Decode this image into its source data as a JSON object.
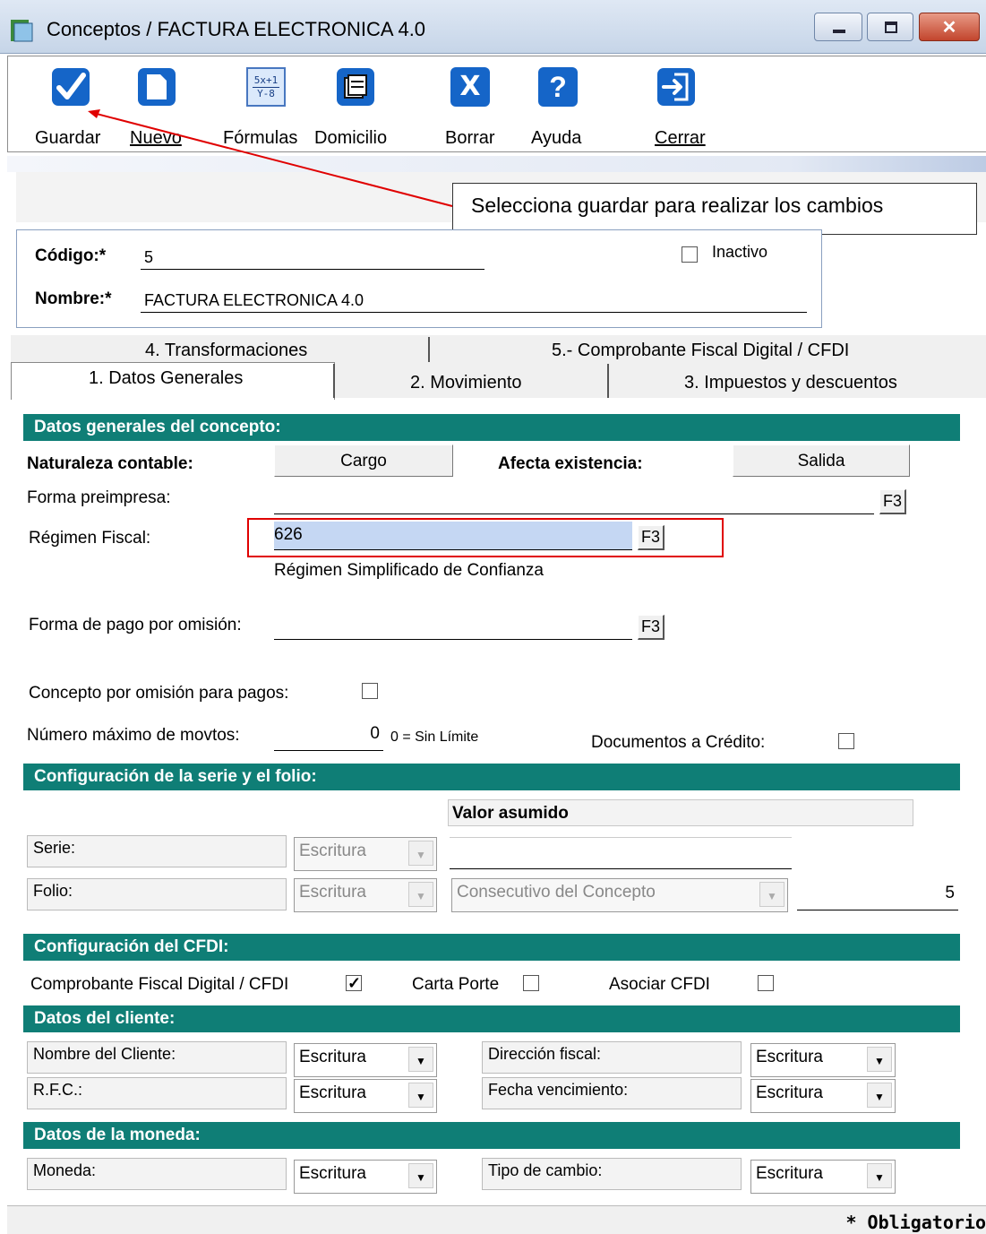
{
  "window": {
    "title": "Conceptos / FACTURA ELECTRONICA 4.0",
    "minimize_glyph": "",
    "maximize_glyph": "",
    "close_glyph": "✕"
  },
  "toolbar": {
    "guardar": "Guardar",
    "nuevo": "Nuevo",
    "formulas": "Fórmulas",
    "formulas_icon_text_top": "5x+1",
    "formulas_icon_text_bottom": "Y-8",
    "domicilio": "Domicilio",
    "borrar": "Borrar",
    "borrar_icon_text": "X",
    "ayuda": "Ayuda",
    "ayuda_icon_text": "?",
    "cerrar": "Cerrar"
  },
  "callout": {
    "text": "Selecciona guardar para realizar los cambios",
    "arrow_color": "#e00000"
  },
  "header": {
    "codigo_label": "Código:*",
    "codigo_value": "5",
    "nombre_label": "Nombre:*",
    "nombre_value": "FACTURA ELECTRONICA 4.0",
    "inactivo_label": "Inactivo",
    "inactivo_checked": false
  },
  "tabs": {
    "row_back": [
      "4. Transformaciones",
      "5.- Comprobante Fiscal Digital / CFDI"
    ],
    "row_front": [
      "1. Datos Generales",
      "2. Movimiento",
      "3. Impuestos y descuentos"
    ],
    "active": "1. Datos Generales"
  },
  "datos_generales": {
    "section_title": "Datos generales del concepto:",
    "naturaleza_label": "Naturaleza contable:",
    "naturaleza_value": "Cargo",
    "afecta_label": "Afecta existencia:",
    "afecta_value": "Salida",
    "forma_preimpresa_label": "Forma preimpresa:",
    "forma_preimpresa_value": "",
    "f3_label": "F3",
    "regimen_label": "Régimen Fiscal:",
    "regimen_value": "626",
    "regimen_desc": "Régimen Simplificado de Confianza",
    "forma_pago_label": "Forma de pago por omisión:",
    "forma_pago_value": "",
    "concepto_pagos_label": "Concepto por omisión para pagos:",
    "concepto_pagos_checked": false,
    "max_movtos_label": "Número máximo de movtos:",
    "max_movtos_value": "0",
    "max_movtos_hint": "0 = Sin Límite",
    "doc_credito_label": "Documentos a Crédito:",
    "doc_credito_checked": false
  },
  "serie_folio": {
    "section_title": "Configuración de la serie y el folio:",
    "valor_asumido_label": "Valor asumido",
    "serie_label": "Serie:",
    "serie_mode": "Escritura",
    "serie_value": "",
    "folio_label": "Folio:",
    "folio_mode": "Escritura",
    "folio_source": "Consecutivo del Concepto",
    "folio_value": "5"
  },
  "cfdi": {
    "section_title": "Configuración del CFDI:",
    "cfdi_label": "Comprobante Fiscal Digital / CFDI",
    "cfdi_checked": true,
    "carta_porte_label": "Carta Porte",
    "carta_porte_checked": false,
    "asociar_label": "Asociar CFDI",
    "asociar_checked": false
  },
  "cliente": {
    "section_title": "Datos del cliente:",
    "nombre_label": "Nombre del Cliente:",
    "nombre_mode": "Escritura",
    "rfc_label": "R.F.C.:",
    "rfc_mode": "Escritura",
    "direccion_label": "Dirección fiscal:",
    "direccion_mode": "Escritura",
    "vencimiento_label": "Fecha vencimiento:",
    "vencimiento_mode": "Escritura"
  },
  "moneda": {
    "section_title": "Datos de la moneda:",
    "moneda_label": "Moneda:",
    "moneda_mode": "Escritura",
    "tipo_cambio_label": "Tipo de cambio:",
    "tipo_cambio_mode": "Escritura"
  },
  "footer": {
    "text": "* Obligatorio"
  },
  "colors": {
    "section_bg": "#0f7e76",
    "highlight_box": "#e00000",
    "selected_field": "#c5d7f3",
    "icon_blue": "#1565c8"
  }
}
